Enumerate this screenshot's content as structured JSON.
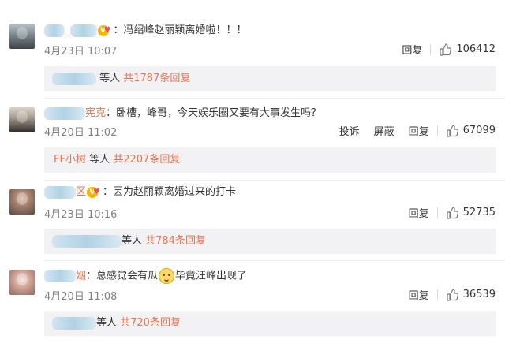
{
  "comments": [
    {
      "username_suffix": "_",
      "colon": "：",
      "text": "冯绍峰赵丽颖离婚啦！！！",
      "time": "4月23日 10:07",
      "actions": [
        "回复"
      ],
      "likes": "106412",
      "reply": {
        "who_suffix": "",
        "plain": " 等人 ",
        "link": "共1787条回复"
      }
    },
    {
      "username_suffix": "宪克",
      "colon": "：",
      "text": "卧槽，峰哥，今天娱乐圈又要有大事发生吗？",
      "time": "4月20日 11:02",
      "actions": [
        "投诉",
        "屏蔽",
        "回复"
      ],
      "likes": "67099",
      "reply": {
        "who_suffix": "FF小树",
        "plain": " 等人 ",
        "link": "共2207条回复"
      }
    },
    {
      "username_suffix": "区",
      "colon": "：",
      "text": "因为赵丽颖离婚过来的打卡",
      "time": "4月23日 10:16",
      "actions": [
        "回复"
      ],
      "likes": "52735",
      "reply": {
        "who_suffix": "",
        "plain": "等人 ",
        "link": "共784条回复"
      }
    },
    {
      "username_suffix": "姻",
      "colon": "：",
      "text_before": "总感觉会有瓜",
      "text_after": "毕竟汪峰出现了",
      "time": "4月20日 11:08",
      "actions": [
        "回复"
      ],
      "likes": "36539",
      "reply": {
        "who_suffix": "",
        "plain": "等人 ",
        "link": "共720条回复"
      }
    }
  ],
  "icons": {
    "like": "thumbs-up-icon",
    "badge": "verified-heart-badge-icon",
    "emoji": "doge-emoji-icon"
  },
  "colors": {
    "username": "#eb7350",
    "link": "#eb7350",
    "meta": "#808080",
    "reply_bg": "#f2f2f5"
  }
}
